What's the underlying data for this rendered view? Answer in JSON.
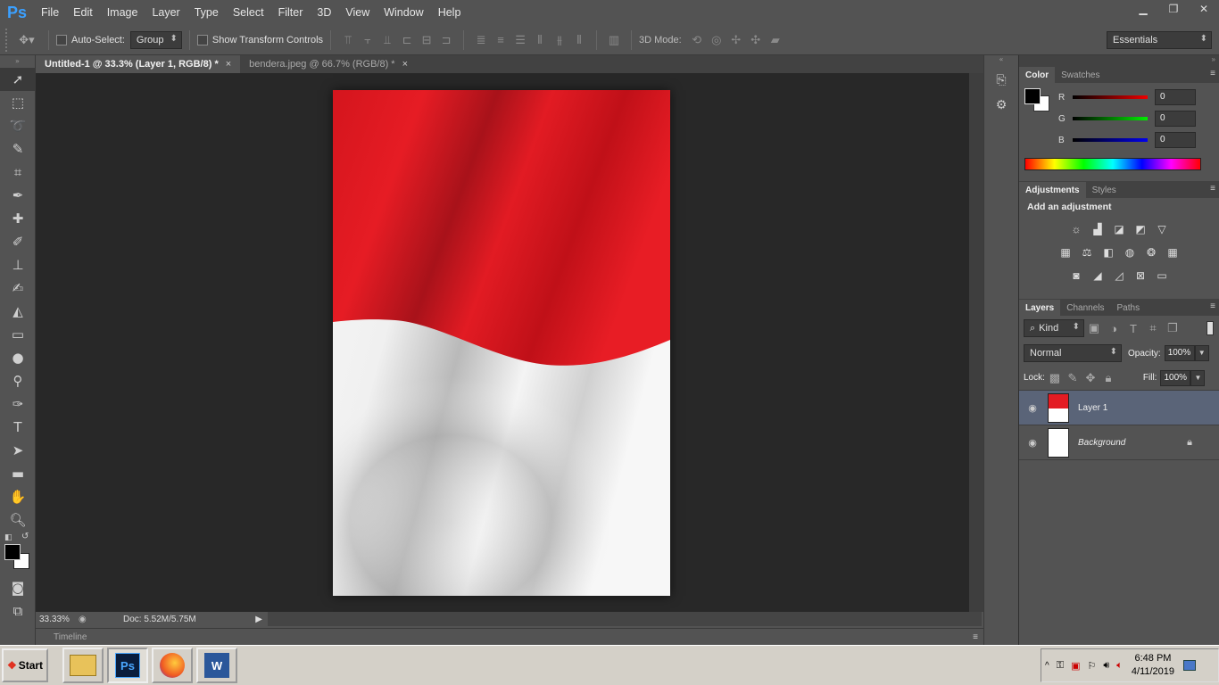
{
  "app": {
    "logo": "Ps"
  },
  "menu": [
    "File",
    "Edit",
    "Image",
    "Layer",
    "Type",
    "Select",
    "Filter",
    "3D",
    "View",
    "Window",
    "Help"
  ],
  "window_controls": {
    "minimize": "▁",
    "restore": "❐",
    "close": "✕"
  },
  "options": {
    "auto_select_label": "Auto-Select:",
    "auto_select_value": "Group",
    "show_transform_label": "Show Transform Controls",
    "mode3d_label": "3D Mode:",
    "workspace": "Essentials"
  },
  "tabs": [
    {
      "label": "Untitled-1 @ 33.3% (Layer 1, RGB/8) *",
      "close": "×"
    },
    {
      "label": "bendera.jpeg @ 66.7% (RGB/8) *",
      "close": "×"
    }
  ],
  "status": {
    "zoom": "33.33%",
    "doc": "Doc: 5.52M/5.75M"
  },
  "timeline_label": "Timeline",
  "color_panel": {
    "tabs": [
      "Color",
      "Swatches"
    ],
    "channels": [
      {
        "label": "R",
        "value": "0",
        "color": "#c81010"
      },
      {
        "label": "G",
        "value": "0",
        "color": "#10b010"
      },
      {
        "label": "B",
        "value": "0",
        "color": "#1010c8"
      }
    ]
  },
  "adjustments_panel": {
    "tabs": [
      "Adjustments",
      "Styles"
    ],
    "heading": "Add an adjustment"
  },
  "layers_panel": {
    "tabs": [
      "Layers",
      "Channels",
      "Paths"
    ],
    "kind_label": "Kind",
    "blend_mode": "Normal",
    "opacity_label": "Opacity:",
    "opacity_value": "100%",
    "lock_label": "Lock:",
    "fill_label": "Fill:",
    "fill_value": "100%",
    "layers": [
      {
        "name": "Layer 1",
        "selected": true
      },
      {
        "name": "Background",
        "selected": false
      }
    ]
  },
  "taskbar": {
    "start": "Start",
    "time": "6:48 PM",
    "date": "4/11/2019"
  },
  "colors": {
    "flag_red": "#e31b23",
    "flag_white": "#f2f2f2",
    "selection": "#5a6478"
  }
}
